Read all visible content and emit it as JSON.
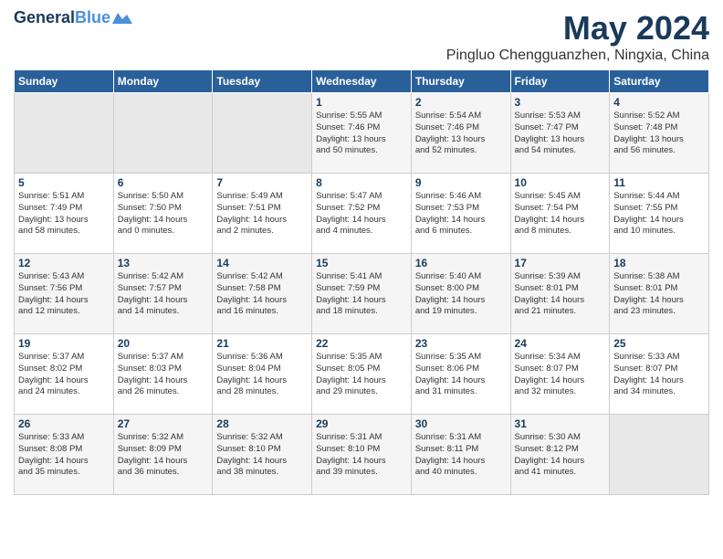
{
  "header": {
    "logo_line1": "General",
    "logo_line2": "Blue",
    "month": "May 2024",
    "location": "Pingluo Chengguanzhen, Ningxia, China"
  },
  "days_of_week": [
    "Sunday",
    "Monday",
    "Tuesday",
    "Wednesday",
    "Thursday",
    "Friday",
    "Saturday"
  ],
  "weeks": [
    [
      {
        "num": "",
        "detail": ""
      },
      {
        "num": "",
        "detail": ""
      },
      {
        "num": "",
        "detail": ""
      },
      {
        "num": "1",
        "detail": "Sunrise: 5:55 AM\nSunset: 7:46 PM\nDaylight: 13 hours\nand 50 minutes."
      },
      {
        "num": "2",
        "detail": "Sunrise: 5:54 AM\nSunset: 7:46 PM\nDaylight: 13 hours\nand 52 minutes."
      },
      {
        "num": "3",
        "detail": "Sunrise: 5:53 AM\nSunset: 7:47 PM\nDaylight: 13 hours\nand 54 minutes."
      },
      {
        "num": "4",
        "detail": "Sunrise: 5:52 AM\nSunset: 7:48 PM\nDaylight: 13 hours\nand 56 minutes."
      }
    ],
    [
      {
        "num": "5",
        "detail": "Sunrise: 5:51 AM\nSunset: 7:49 PM\nDaylight: 13 hours\nand 58 minutes."
      },
      {
        "num": "6",
        "detail": "Sunrise: 5:50 AM\nSunset: 7:50 PM\nDaylight: 14 hours\nand 0 minutes."
      },
      {
        "num": "7",
        "detail": "Sunrise: 5:49 AM\nSunset: 7:51 PM\nDaylight: 14 hours\nand 2 minutes."
      },
      {
        "num": "8",
        "detail": "Sunrise: 5:47 AM\nSunset: 7:52 PM\nDaylight: 14 hours\nand 4 minutes."
      },
      {
        "num": "9",
        "detail": "Sunrise: 5:46 AM\nSunset: 7:53 PM\nDaylight: 14 hours\nand 6 minutes."
      },
      {
        "num": "10",
        "detail": "Sunrise: 5:45 AM\nSunset: 7:54 PM\nDaylight: 14 hours\nand 8 minutes."
      },
      {
        "num": "11",
        "detail": "Sunrise: 5:44 AM\nSunset: 7:55 PM\nDaylight: 14 hours\nand 10 minutes."
      }
    ],
    [
      {
        "num": "12",
        "detail": "Sunrise: 5:43 AM\nSunset: 7:56 PM\nDaylight: 14 hours\nand 12 minutes."
      },
      {
        "num": "13",
        "detail": "Sunrise: 5:42 AM\nSunset: 7:57 PM\nDaylight: 14 hours\nand 14 minutes."
      },
      {
        "num": "14",
        "detail": "Sunrise: 5:42 AM\nSunset: 7:58 PM\nDaylight: 14 hours\nand 16 minutes."
      },
      {
        "num": "15",
        "detail": "Sunrise: 5:41 AM\nSunset: 7:59 PM\nDaylight: 14 hours\nand 18 minutes."
      },
      {
        "num": "16",
        "detail": "Sunrise: 5:40 AM\nSunset: 8:00 PM\nDaylight: 14 hours\nand 19 minutes."
      },
      {
        "num": "17",
        "detail": "Sunrise: 5:39 AM\nSunset: 8:01 PM\nDaylight: 14 hours\nand 21 minutes."
      },
      {
        "num": "18",
        "detail": "Sunrise: 5:38 AM\nSunset: 8:01 PM\nDaylight: 14 hours\nand 23 minutes."
      }
    ],
    [
      {
        "num": "19",
        "detail": "Sunrise: 5:37 AM\nSunset: 8:02 PM\nDaylight: 14 hours\nand 24 minutes."
      },
      {
        "num": "20",
        "detail": "Sunrise: 5:37 AM\nSunset: 8:03 PM\nDaylight: 14 hours\nand 26 minutes."
      },
      {
        "num": "21",
        "detail": "Sunrise: 5:36 AM\nSunset: 8:04 PM\nDaylight: 14 hours\nand 28 minutes."
      },
      {
        "num": "22",
        "detail": "Sunrise: 5:35 AM\nSunset: 8:05 PM\nDaylight: 14 hours\nand 29 minutes."
      },
      {
        "num": "23",
        "detail": "Sunrise: 5:35 AM\nSunset: 8:06 PM\nDaylight: 14 hours\nand 31 minutes."
      },
      {
        "num": "24",
        "detail": "Sunrise: 5:34 AM\nSunset: 8:07 PM\nDaylight: 14 hours\nand 32 minutes."
      },
      {
        "num": "25",
        "detail": "Sunrise: 5:33 AM\nSunset: 8:07 PM\nDaylight: 14 hours\nand 34 minutes."
      }
    ],
    [
      {
        "num": "26",
        "detail": "Sunrise: 5:33 AM\nSunset: 8:08 PM\nDaylight: 14 hours\nand 35 minutes."
      },
      {
        "num": "27",
        "detail": "Sunrise: 5:32 AM\nSunset: 8:09 PM\nDaylight: 14 hours\nand 36 minutes."
      },
      {
        "num": "28",
        "detail": "Sunrise: 5:32 AM\nSunset: 8:10 PM\nDaylight: 14 hours\nand 38 minutes."
      },
      {
        "num": "29",
        "detail": "Sunrise: 5:31 AM\nSunset: 8:10 PM\nDaylight: 14 hours\nand 39 minutes."
      },
      {
        "num": "30",
        "detail": "Sunrise: 5:31 AM\nSunset: 8:11 PM\nDaylight: 14 hours\nand 40 minutes."
      },
      {
        "num": "31",
        "detail": "Sunrise: 5:30 AM\nSunset: 8:12 PM\nDaylight: 14 hours\nand 41 minutes."
      },
      {
        "num": "",
        "detail": ""
      }
    ]
  ]
}
